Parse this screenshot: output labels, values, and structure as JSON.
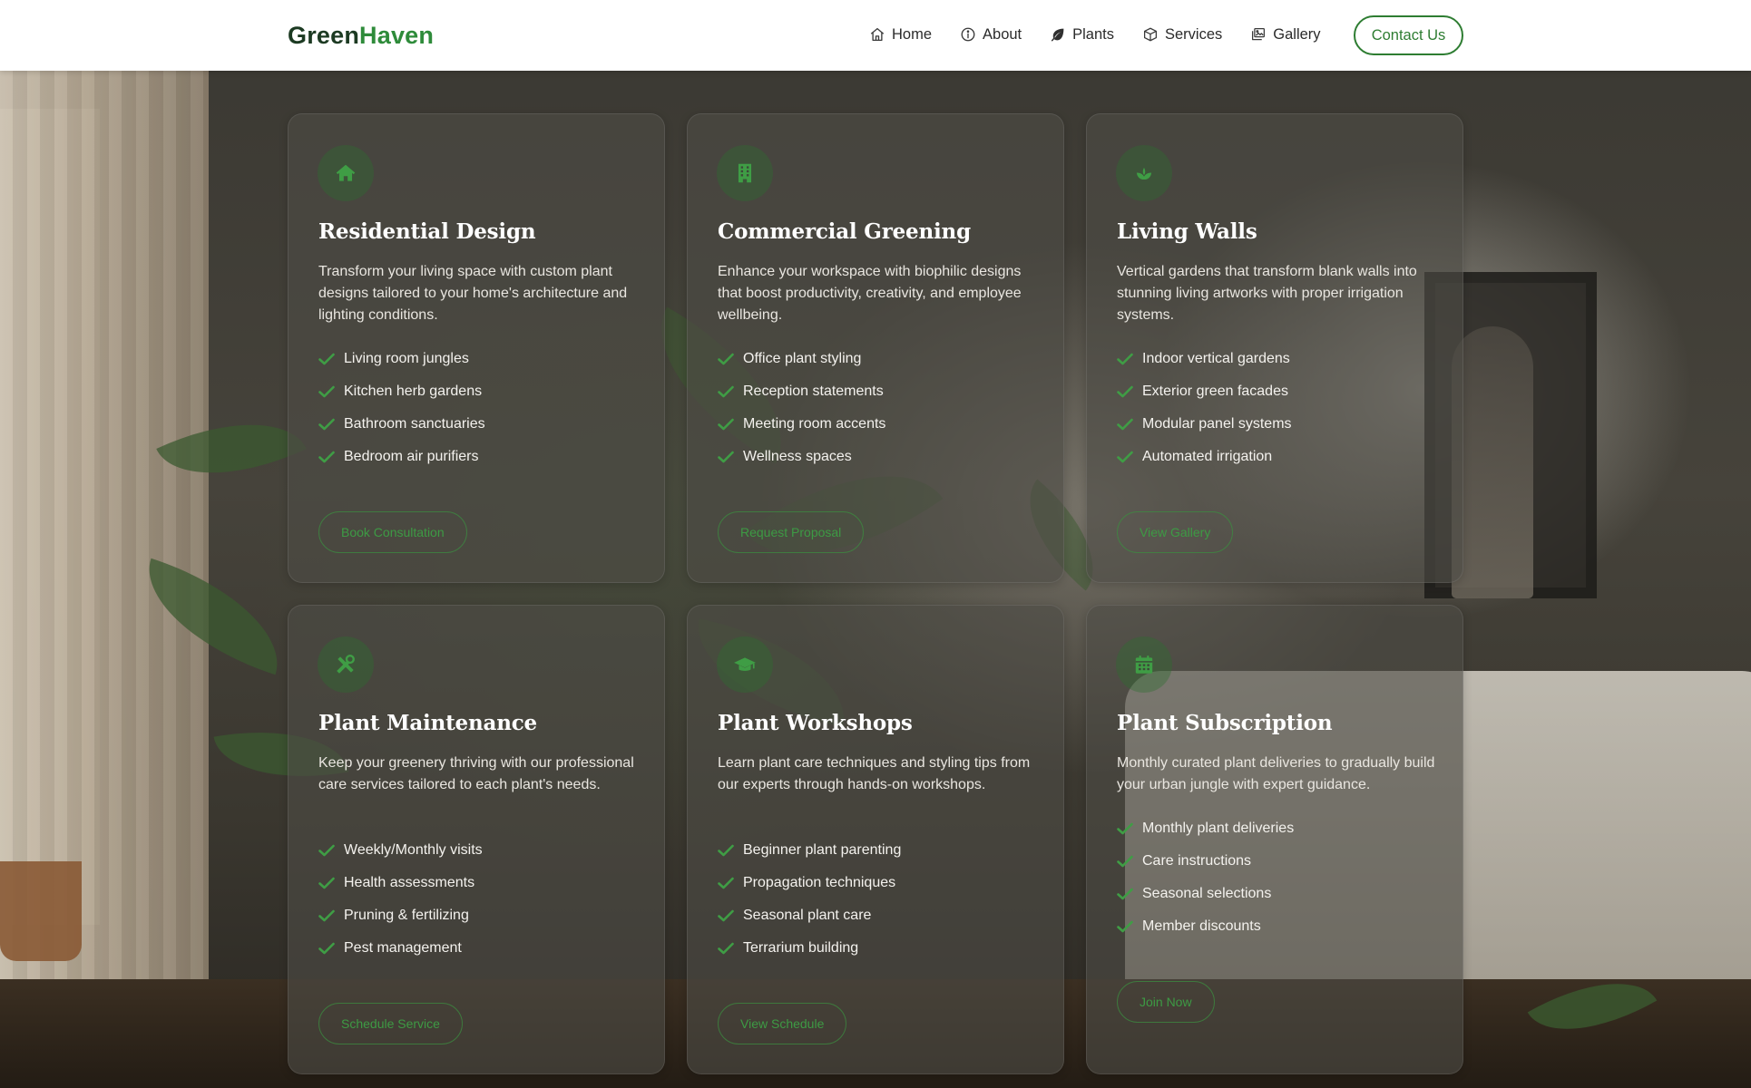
{
  "brand": {
    "name_first": "Green",
    "name_second": "Haven",
    "colors": {
      "dark": "#1c3a22",
      "accent": "#2e8b3a"
    }
  },
  "nav": {
    "items": [
      {
        "label": "Home",
        "icon": "home-icon"
      },
      {
        "label": "About",
        "icon": "info-icon"
      },
      {
        "label": "Plants",
        "icon": "leaf-icon"
      },
      {
        "label": "Services",
        "icon": "box-icon"
      },
      {
        "label": "Gallery",
        "icon": "images-icon"
      }
    ],
    "contact_label": "Contact Us"
  },
  "services": [
    {
      "icon": "house-icon",
      "title": "Residential Design",
      "description": "Transform your living space with custom plant designs tailored to your home's architecture and lighting conditions.",
      "features": [
        "Living room jungles",
        "Kitchen herb gardens",
        "Bathroom sanctuaries",
        "Bedroom air purifiers"
      ],
      "cta": "Book Consultation"
    },
    {
      "icon": "building-icon",
      "title": "Commercial Greening",
      "description": "Enhance your workspace with biophilic designs that boost productivity, creativity, and employee wellbeing.",
      "features": [
        "Office plant styling",
        "Reception statements",
        "Meeting room accents",
        "Wellness spaces"
      ],
      "cta": "Request Proposal"
    },
    {
      "icon": "seedling-icon",
      "title": "Living Walls",
      "description": "Vertical gardens that transform blank walls into stunning living artworks with proper irrigation systems.",
      "features": [
        "Indoor vertical gardens",
        "Exterior green facades",
        "Modular panel systems",
        "Automated irrigation"
      ],
      "cta": "View Gallery"
    },
    {
      "icon": "tools-icon",
      "title": "Plant Maintenance",
      "description": "Keep your greenery thriving with our professional care services tailored to each plant's needs.",
      "features": [
        "Weekly/Monthly visits",
        "Health assessments",
        "Pruning & fertilizing",
        "Pest management"
      ],
      "cta": "Schedule Service"
    },
    {
      "icon": "graduation-cap-icon",
      "title": "Plant Workshops",
      "description": "Learn plant care techniques and styling tips from our experts through hands-on workshops.",
      "features": [
        "Beginner plant parenting",
        "Propagation techniques",
        "Seasonal plant care",
        "Terrarium building"
      ],
      "cta": "View Schedule"
    },
    {
      "icon": "calendar-icon",
      "title": "Plant Subscription",
      "description": "Monthly curated plant deliveries to gradually build your urban jungle with expert guidance.",
      "features": [
        "Monthly plant deliveries",
        "Care instructions",
        "Seasonal selections",
        "Member discounts"
      ],
      "cta": "Join Now"
    }
  ],
  "colors": {
    "cta_border": "#3c8c40",
    "cta_text": "#3d9a44",
    "check": "#3f9d45",
    "icon_bg": "#2e6e30"
  }
}
